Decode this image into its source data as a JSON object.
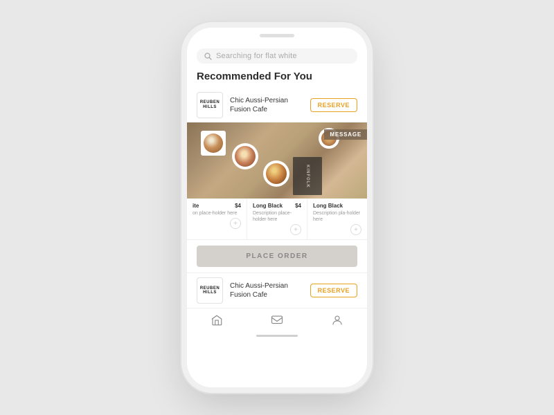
{
  "phone": {
    "search": {
      "placeholder": "Searching for flat white"
    },
    "section_title": "Recommended For You",
    "restaurant1": {
      "logo_line1": "REUBEN",
      "logo_line2": "HILLS",
      "description": "Chic Aussi-Persian Fusion Cafe",
      "reserve_label": "RESERVE"
    },
    "coffee_image": {
      "badge_text": "MESSAGE",
      "watermark_text": "KINFOLK"
    },
    "menu_items": [
      {
        "name": "ite",
        "price": "$4",
        "desc": "on place-holder here"
      },
      {
        "name": "Long Black",
        "price": "$4",
        "desc": "Description place-holder here"
      },
      {
        "name": "Long Black",
        "price": "",
        "desc": "Description pla-holder here"
      }
    ],
    "place_order_label": "PLACE ORDER",
    "restaurant2": {
      "logo_line1": "REUBEN",
      "logo_line2": "HILLS",
      "description": "Chic Aussi-Persian Fusion Cafe",
      "reserve_label": "RESERVE"
    },
    "nav": {
      "home_label": "home",
      "messages_label": "messages",
      "profile_label": "profile"
    }
  }
}
